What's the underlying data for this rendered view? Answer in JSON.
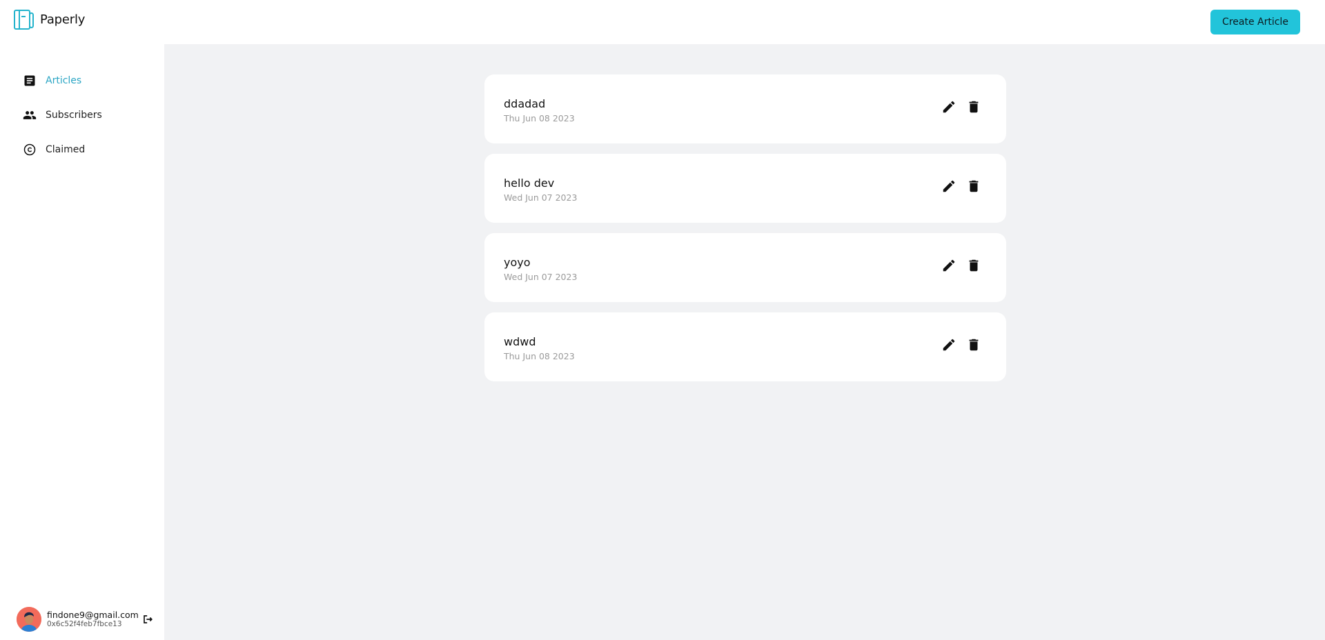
{
  "brand": {
    "name": "Paperly"
  },
  "header": {
    "create_label": "Create Article"
  },
  "sidebar": {
    "items": [
      {
        "label": "Articles",
        "icon": "article-icon",
        "active": true
      },
      {
        "label": "Subscribers",
        "icon": "people-icon",
        "active": false
      },
      {
        "label": "Claimed",
        "icon": "copyright-icon",
        "active": false
      }
    ]
  },
  "user": {
    "email": "findone9@gmail.com",
    "wallet": "0x6c52f4feb7fbce13"
  },
  "articles": [
    {
      "title": "ddadad",
      "date": "Thu Jun 08 2023"
    },
    {
      "title": "hello dev",
      "date": "Wed Jun 07 2023"
    },
    {
      "title": "yoyo",
      "date": "Wed Jun 07 2023"
    },
    {
      "title": "wdwd",
      "date": "Thu Jun 08 2023"
    }
  ],
  "colors": {
    "accent": "#22c4da",
    "active_nav": "#2aa5c4",
    "background": "#f1f2f4"
  }
}
